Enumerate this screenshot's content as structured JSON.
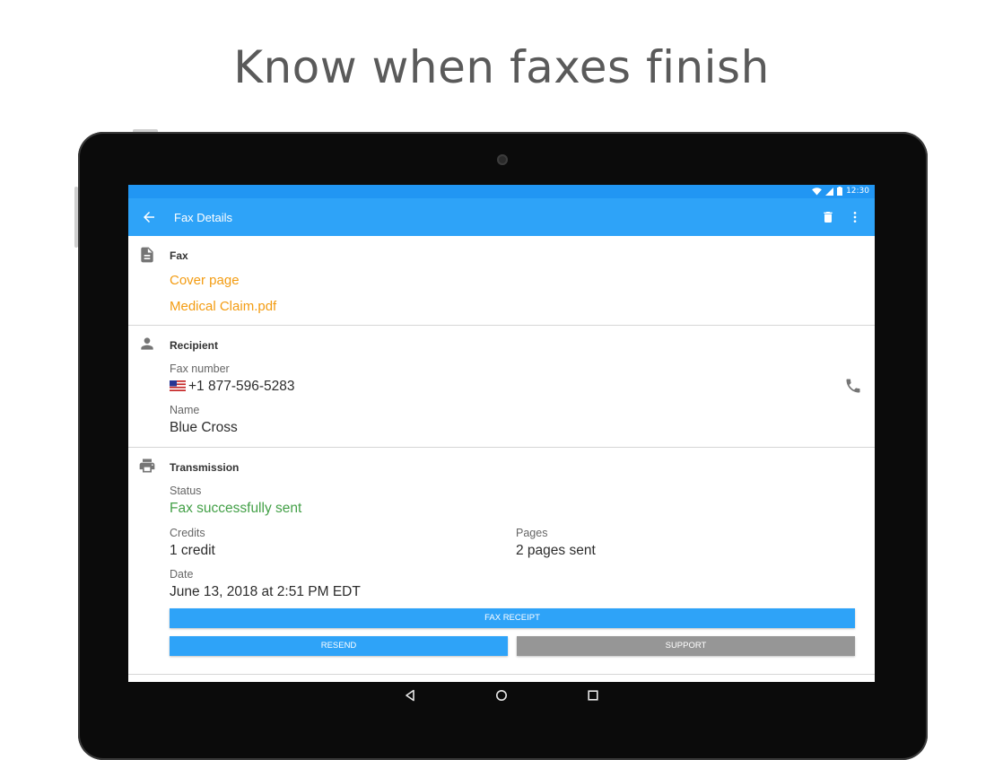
{
  "headline": "Know when faxes finish",
  "statusbar": {
    "time": "12:30"
  },
  "appbar": {
    "title": "Fax Details"
  },
  "fax": {
    "title": "Fax",
    "items": [
      "Cover page",
      "Medical Claim.pdf"
    ]
  },
  "recipient": {
    "title": "Recipient",
    "fax_number_label": "Fax number",
    "fax_number": "+1 877-596-5283",
    "name_label": "Name",
    "name": "Blue Cross"
  },
  "transmission": {
    "title": "Transmission",
    "status_label": "Status",
    "status": "Fax successfully sent",
    "credits_label": "Credits",
    "credits": "1 credit",
    "pages_label": "Pages",
    "pages": "2 pages sent",
    "date_label": "Date",
    "date": "June 13, 2018 at 2:51 PM EDT"
  },
  "buttons": {
    "fax_receipt": "FAX RECEIPT",
    "resend": "RESEND",
    "support": "SUPPORT"
  },
  "icons": [
    "back-arrow-icon",
    "trash-icon",
    "more-vert-icon",
    "document-icon",
    "person-icon",
    "phone-icon",
    "printer-icon",
    "wifi-icon",
    "signal-icon",
    "battery-icon",
    "nav-back-icon",
    "nav-home-icon",
    "nav-recents-icon"
  ],
  "colors": {
    "primary": "#2ea3f8",
    "status_bar": "#2196f3",
    "link": "#f39c12",
    "success": "#43a047",
    "support_button": "#969696"
  }
}
